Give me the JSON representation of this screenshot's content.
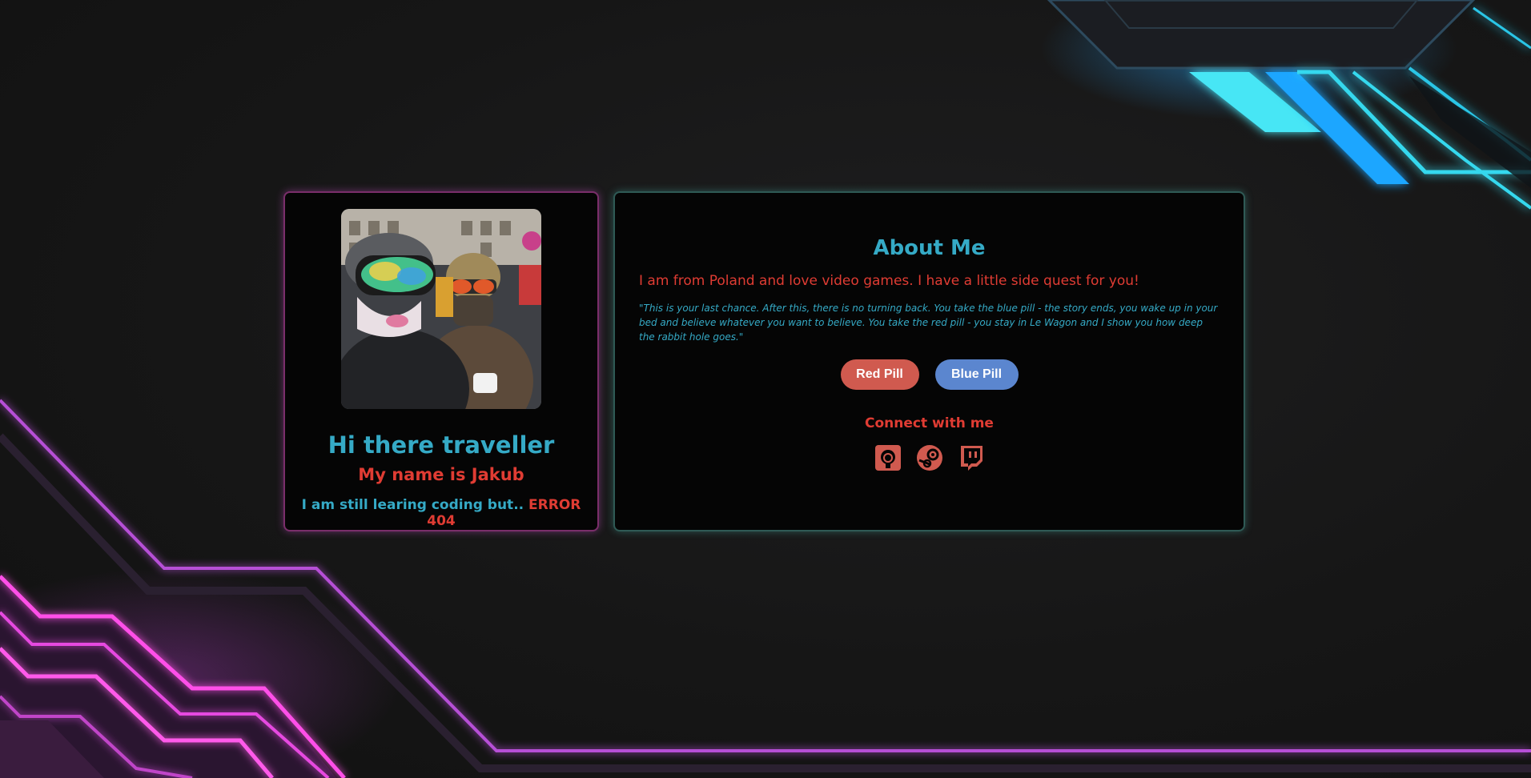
{
  "profile": {
    "greeting": "Hi there traveller",
    "name": "My name is Jakub",
    "status_text": "I am still learing coding but..",
    "status_error": "ERROR 404"
  },
  "about": {
    "title": "About Me",
    "intro": "I am from Poland and love video games. I have a little side quest for you!",
    "quote": "\"This is your last chance. After this, there is no turning back. You take the blue pill - the story ends, you wake up in your bed and believe whatever you want to believe. You take the red pill - you stay in Le Wagon and I show you how deep the rabbit hole goes.\"",
    "red_pill_label": "Red Pill",
    "blue_pill_label": "Blue Pill",
    "connect_label": "Connect with me",
    "socials": [
      "github-icon",
      "steam-icon",
      "twitch-icon"
    ]
  },
  "colors": {
    "accent_cyan": "#35aac6",
    "accent_red": "#e03c33",
    "red_pill": "#d05a4f",
    "blue_pill": "#5b86cf"
  }
}
